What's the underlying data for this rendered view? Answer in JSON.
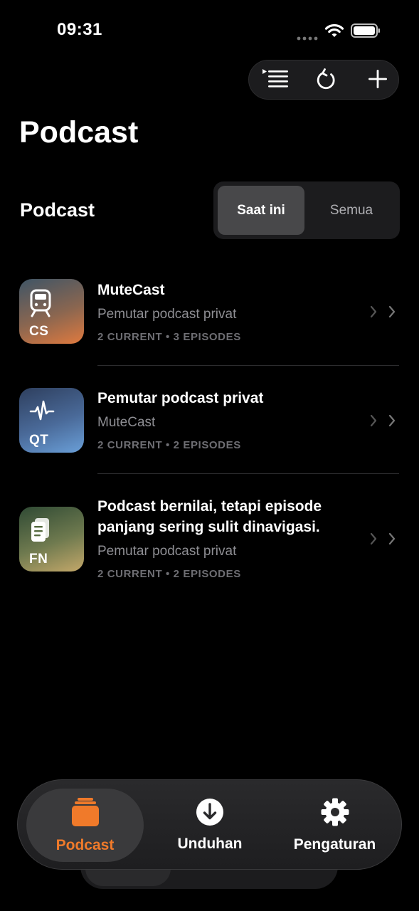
{
  "status_bar": {
    "time": "09:31"
  },
  "header": {
    "title": "Podcast"
  },
  "section": {
    "title": "Podcast",
    "segments": [
      {
        "label": "Saat ini",
        "selected": true
      },
      {
        "label": "Semua",
        "selected": false
      }
    ]
  },
  "podcasts": [
    {
      "code": "CS",
      "icon": "train-icon",
      "title": "MuteCast",
      "subtitle": "Pemutar podcast privat",
      "meta": "2 CURRENT • 3 EPISODES",
      "colors": [
        "#3f5566",
        "#e07a3f"
      ]
    },
    {
      "code": "QT",
      "icon": "pulse-icon",
      "title": "Pemutar podcast privat",
      "subtitle": "MuteCast",
      "meta": "2 CURRENT • 2 EPISODES",
      "colors": [
        "#2e3f5e",
        "#6a9fd8"
      ]
    },
    {
      "code": "FN",
      "icon": "document-icon",
      "title": "Podcast bernilai, tetapi episode panjang sering sulit dinavigasi.",
      "subtitle": "Pemutar podcast privat",
      "meta": "2 CURRENT • 2 EPISODES",
      "colors": [
        "#2f4a34",
        "#c4a86a"
      ]
    }
  ],
  "tabbar": {
    "tabs": [
      {
        "label": "Podcast",
        "icon": "podcast-stack-icon",
        "active": true
      },
      {
        "label": "Unduhan",
        "icon": "download-icon",
        "active": false
      },
      {
        "label": "Pengaturan",
        "icon": "gear-icon",
        "active": false
      }
    ]
  },
  "colors": {
    "accent": "#f07a2a",
    "background": "#000000",
    "secondary_text": "#8e8e93"
  }
}
